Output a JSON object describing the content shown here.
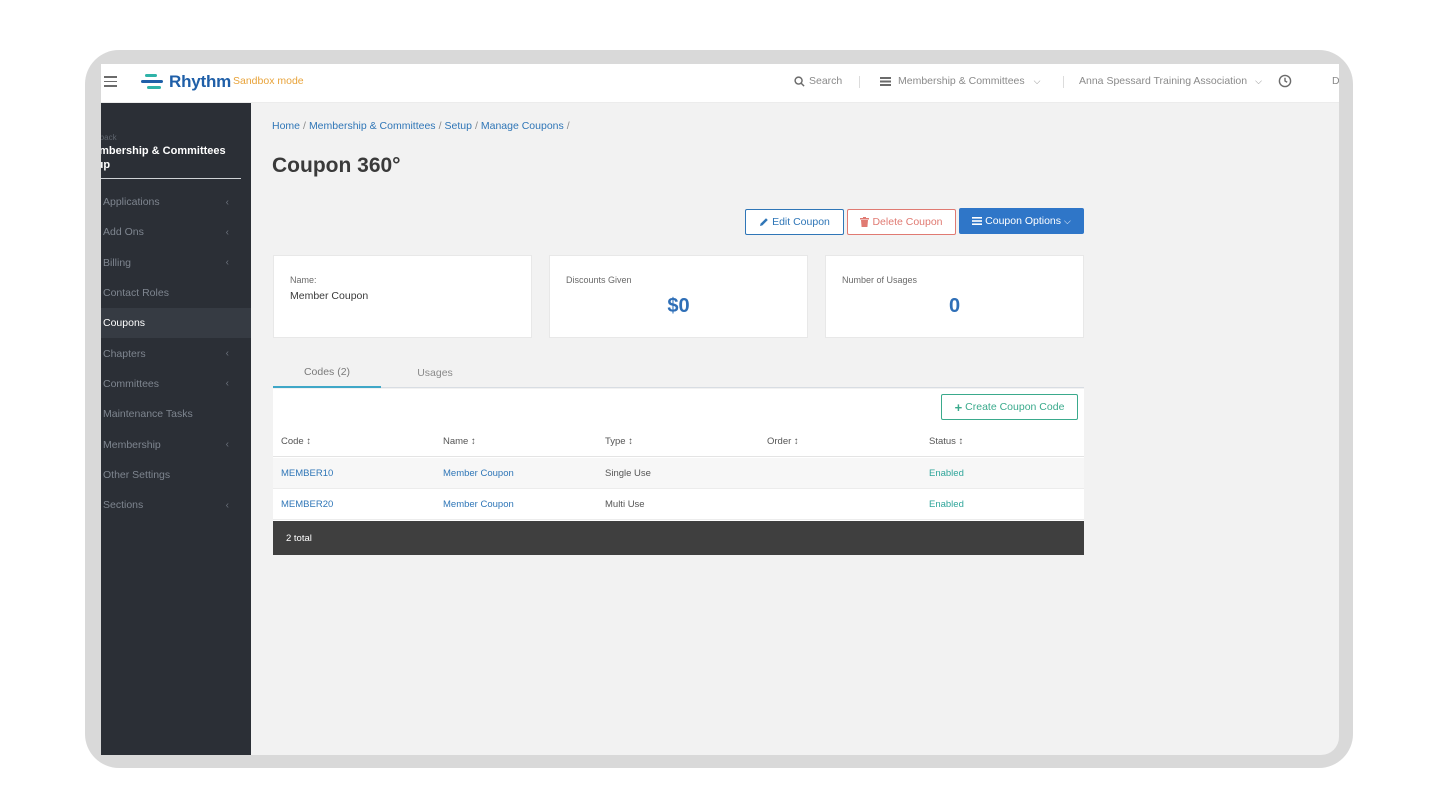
{
  "topbar": {
    "brand": "Rhythm",
    "mode": "Sandbox mode",
    "search_label": "Search",
    "module_label": "Membership & Committees",
    "org_label": "Anna Spessard Training Association",
    "user_initial": "D"
  },
  "sidebar": {
    "back_label": "o back",
    "title": "embership & Committees\ntup",
    "items": [
      {
        "label": "Applications",
        "chevron": "‹"
      },
      {
        "label": "Add Ons",
        "chevron": "‹"
      },
      {
        "label": "Billing",
        "chevron": "‹"
      },
      {
        "label": "Contact Roles",
        "chevron": ""
      },
      {
        "label": "Coupons",
        "chevron": ""
      },
      {
        "label": "Chapters",
        "chevron": "‹"
      },
      {
        "label": "Committees",
        "chevron": "‹"
      },
      {
        "label": "Maintenance Tasks",
        "chevron": ""
      },
      {
        "label": "Membership",
        "chevron": "‹"
      },
      {
        "label": "Other Settings",
        "chevron": ""
      },
      {
        "label": "Sections",
        "chevron": "‹"
      }
    ],
    "active_index": 4
  },
  "breadcrumb": [
    "Home",
    "Membership & Committees",
    "Setup",
    "Manage Coupons"
  ],
  "page_title": "Coupon 360°",
  "actions": {
    "edit": "Edit Coupon",
    "delete": "Delete Coupon",
    "options": "Coupon Options"
  },
  "cards": {
    "name_label": "Name:",
    "name_value": "Member Coupon",
    "discounts_label": "Discounts Given",
    "discounts_value": "$0",
    "usages_label": "Number of Usages",
    "usages_value": "0"
  },
  "tabs": [
    {
      "label": "Codes (2)",
      "active": true
    },
    {
      "label": "Usages",
      "active": false
    }
  ],
  "table": {
    "create_label": "Create Coupon Code",
    "columns": [
      "Code ↕",
      "Name ↕",
      "Type ↕",
      "Order ↕",
      "Status ↕"
    ],
    "rows": [
      {
        "code": "MEMBER10",
        "name": "Member Coupon",
        "type": "Single Use",
        "order": "",
        "status": "Enabled"
      },
      {
        "code": "MEMBER20",
        "name": "Member Coupon",
        "type": "Multi Use",
        "order": "",
        "status": "Enabled"
      }
    ],
    "footer": "2 total"
  },
  "colors": {
    "primary": "#2f76c8",
    "danger": "#e07a72",
    "success": "#3aaa8c",
    "sidebar_bg": "#2b2f36",
    "sandbox": "#e8a33a"
  },
  "icons": {
    "menu": "hamburger-icon",
    "search": "search-icon",
    "module": "list-icon",
    "clock": "clock-icon",
    "edit": "pencil-icon",
    "delete": "trash-icon",
    "options": "bars-icon",
    "create": "plus-icon"
  }
}
